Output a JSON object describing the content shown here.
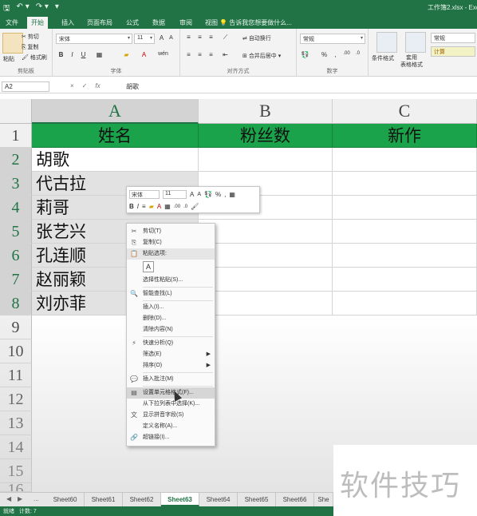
{
  "titlebar": {
    "save_icon": "save-icon",
    "undo": "↶ ▾",
    "redo": "↷ ▾",
    "more": "▾",
    "title": "工作簿2.xlsx - Exc"
  },
  "tabs": [
    "文件",
    "开始",
    "插入",
    "页面布局",
    "公式",
    "数据",
    "审阅",
    "视图"
  ],
  "active_tab": "开始",
  "tell_me": "告诉我您想要做什么...",
  "ribbon": {
    "clipboard": {
      "paste": "粘贴",
      "cut": "剪切",
      "copy": "复制",
      "painter": "格式刷",
      "label": "剪贴板"
    },
    "font": {
      "name": "宋体",
      "size": "11",
      "grow": "A",
      "shrink": "A",
      "bold": "B",
      "italic": "I",
      "underline": "U",
      "wen": "wén",
      "label": "字体"
    },
    "align": {
      "wrap": "自动换行",
      "merge": "合并后居中",
      "label": "对齐方式"
    },
    "number": {
      "format": "常规",
      "percent": "%",
      "comma": ",",
      "label": "数字"
    },
    "styles": {
      "conditional": "条件格式",
      "table": "套用\n表格格式",
      "normal": "常规",
      "calc": "计算"
    }
  },
  "formula_bar": {
    "name_box": "A2",
    "cancel": "×",
    "enter": "✓",
    "fx": "fx",
    "content": "胡歌"
  },
  "columns": [
    "A",
    "B",
    "C"
  ],
  "rows": [
    "1",
    "2",
    "3",
    "4",
    "5",
    "6",
    "7",
    "8",
    "9",
    "10",
    "11",
    "12",
    "13",
    "14",
    "15",
    "16"
  ],
  "table": {
    "headers": [
      "姓名",
      "粉丝数",
      "新作"
    ],
    "names": [
      "胡歌",
      "代古拉",
      "莉哥",
      "张艺兴",
      "孔连顺",
      "赵丽颖",
      "刘亦菲"
    ]
  },
  "mini_toolbar": {
    "font": "宋体",
    "size": "11",
    "grow": "A",
    "shrink": "A",
    "percent": "%",
    "bold": "B",
    "italic": "I"
  },
  "context_menu": {
    "items": [
      {
        "label": "剪切(T)",
        "icon": "scissors-icon"
      },
      {
        "label": "复制(C)",
        "icon": "copy-icon"
      },
      {
        "label": "粘贴选项:",
        "icon": "paste-icon"
      },
      {
        "label": "选择性粘贴(S)...",
        "icon": ""
      },
      {
        "label": "智能查找(L)",
        "icon": "search-icon"
      },
      {
        "label": "插入(I)...",
        "icon": ""
      },
      {
        "label": "删除(D)...",
        "icon": ""
      },
      {
        "label": "清除内容(N)",
        "icon": ""
      },
      {
        "label": "快速分析(Q)",
        "icon": "quick-analysis-icon"
      },
      {
        "label": "筛选(E)",
        "icon": ""
      },
      {
        "label": "排序(O)",
        "icon": ""
      },
      {
        "label": "插入批注(M)",
        "icon": "comment-icon"
      },
      {
        "label": "设置单元格格式(F)...",
        "icon": "format-cells-icon"
      },
      {
        "label": "从下拉列表中选择(K)...",
        "icon": ""
      },
      {
        "label": "显示拼音字段(S)",
        "icon": "phonetic-icon"
      },
      {
        "label": "定义名称(A)...",
        "icon": ""
      },
      {
        "label": "超链接(I)...",
        "icon": "hyperlink-icon"
      }
    ],
    "paste_option": "A"
  },
  "sheet_nav": {
    "prev": "◀",
    "next": "▶",
    "ellipsis": "..."
  },
  "sheets": [
    "Sheet60",
    "Sheet61",
    "Sheet62",
    "Sheet63",
    "Sheet64",
    "Sheet65",
    "Sheet66",
    "She"
  ],
  "active_sheet": "Sheet63",
  "status": {
    "left": "就绪",
    "count": "计数: 7"
  },
  "watermark": "软件技巧",
  "colors": {
    "excel_green": "#217346",
    "header_fill": "#1aa34a"
  }
}
